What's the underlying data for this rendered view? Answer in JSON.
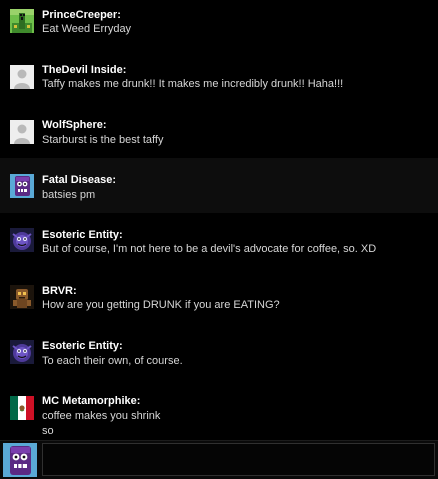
{
  "messages": [
    {
      "user": "PrinceCreeper:",
      "lines": [
        "Eat Weed Erryday"
      ],
      "avatar_icon": "creeper-avatar-icon"
    },
    {
      "user": "TheDevil Inside:",
      "lines": [
        "Taffy makes me drunk!! It makes me incredibly drunk!! Haha!!!"
      ],
      "avatar_icon": "default-user-avatar-icon"
    },
    {
      "user": "WolfSphere:",
      "lines": [
        "Starburst is the best taffy"
      ],
      "avatar_icon": "default-user-avatar-icon"
    },
    {
      "user": "Fatal Disease:",
      "lines": [
        "batsies pm"
      ],
      "avatar_icon": "purple-monster-avatar-icon"
    },
    {
      "user": "Esoteric Entity:",
      "lines": [
        "But of course, I'm not here to be a devil's advocate for coffee, so. XD"
      ],
      "avatar_icon": "purple-creature-avatar-icon"
    },
    {
      "user": "BRVR:",
      "lines": [
        "How are you getting DRUNK if you are EATING?"
      ],
      "avatar_icon": "brown-creature-avatar-icon"
    },
    {
      "user": "Esoteric Entity:",
      "lines": [
        "To each their own, of course."
      ],
      "avatar_icon": "purple-creature-avatar-icon"
    },
    {
      "user": "MC Metamorphike:",
      "lines": [
        "coffee makes you shrink",
        "so"
      ],
      "avatar_icon": "mexico-flag-avatar-icon"
    }
  ],
  "composer": {
    "value": "",
    "avatar_icon": "purple-monster-avatar-icon"
  },
  "colors": {
    "background": "#000000",
    "highlight_row": "#0d0d0d",
    "username": "#ffffff",
    "message_text": "#d6d6d6"
  }
}
